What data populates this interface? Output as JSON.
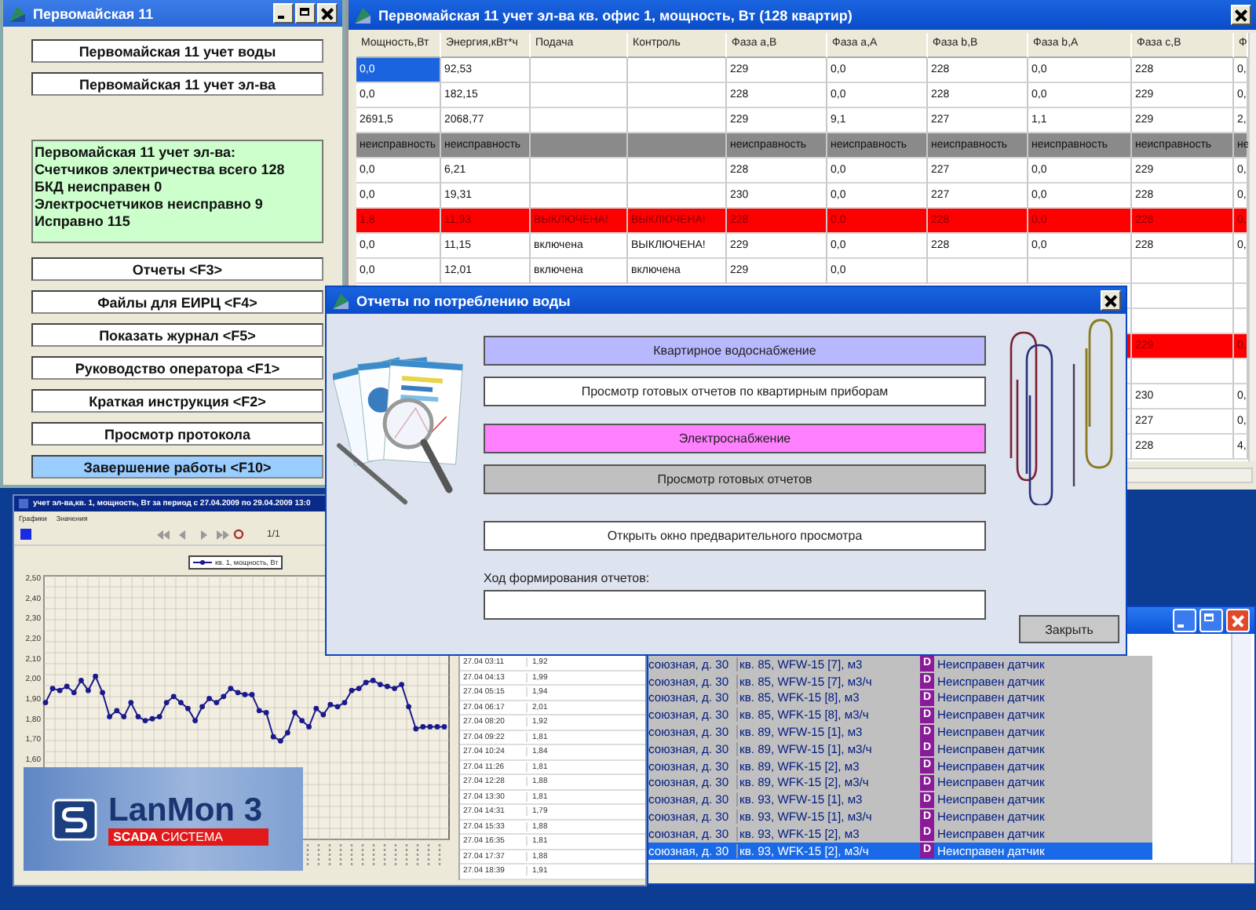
{
  "main_window": {
    "title": "Первомайская 11",
    "top_buttons": [
      "Первомайская 11 учет воды",
      "Первомайская 11 учет эл-ва"
    ],
    "info_lines": [
      "Первомайская 11 учет эл-ва:",
      "Счетчиков электричества всего 128",
      "БКД неисправен 0",
      "Электросчетчиков неисправно 9",
      "Исправно 115"
    ],
    "buttons": [
      {
        "label": "Отчеты <F3>",
        "selected": false
      },
      {
        "label": "Файлы для ЕИРЦ <F4>",
        "selected": false
      },
      {
        "label": "Показать журнал <F5>",
        "selected": false
      },
      {
        "label": "Руководство оператора <F1>",
        "selected": false
      },
      {
        "label": "Краткая инструкция <F2>",
        "selected": false
      },
      {
        "label": "Просмотр протокола",
        "selected": false
      },
      {
        "label": "Завершение работы <F10>",
        "selected": true
      }
    ]
  },
  "table_window": {
    "title": "Первомайская 11 учет эл-ва кв. офис 1, мощность, Вт (128 квартир)",
    "columns": [
      "Мощность,Вт",
      "Энергия,кВт*ч",
      "Подача",
      "Контроль",
      "Фаза a,В",
      "Фаза a,А",
      "Фаза b,В",
      "Фаза b,А",
      "Фаза c,В",
      "Ф"
    ],
    "rows": [
      {
        "kind": "normal",
        "selected": true,
        "cells": [
          "0,0",
          "92,53",
          null,
          null,
          "229",
          "0,0",
          "228",
          "0,0",
          "228",
          "0,"
        ]
      },
      {
        "kind": "normal",
        "selected": false,
        "cells": [
          "0,0",
          "182,15",
          null,
          null,
          "228",
          "0,0",
          "228",
          "0,0",
          "229",
          "0,"
        ]
      },
      {
        "kind": "normal",
        "selected": false,
        "cells": [
          "2691,5",
          "2068,77",
          null,
          null,
          "229",
          "9,1",
          "227",
          "1,1",
          "229",
          "2,"
        ]
      },
      {
        "kind": "fault",
        "selected": false,
        "cells": [
          "неисправность",
          "неисправность",
          null,
          null,
          "неисправность",
          "неисправность",
          "неисправность",
          "неисправность",
          "неисправность",
          "не"
        ]
      },
      {
        "kind": "normal",
        "selected": false,
        "cells": [
          "0,0",
          "6,21",
          null,
          null,
          "228",
          "0,0",
          "227",
          "0,0",
          "229",
          "0,"
        ]
      },
      {
        "kind": "normal",
        "selected": false,
        "cells": [
          "0,0",
          "19,31",
          null,
          null,
          "230",
          "0,0",
          "227",
          "0,0",
          "228",
          "0,"
        ]
      },
      {
        "kind": "alarm",
        "selected": false,
        "cells": [
          "1,8",
          "11,93",
          "ВЫКЛЮЧЕНА!",
          "ВЫКЛЮЧЕНА!",
          "228",
          "0,0",
          "228",
          "0,0",
          "228",
          "0,"
        ]
      },
      {
        "kind": "normal",
        "selected": false,
        "cells": [
          "0,0",
          "11,15",
          "включена",
          "ВЫКЛЮЧЕНА!",
          "229",
          "0,0",
          "228",
          "0,0",
          "228",
          "0,"
        ]
      },
      {
        "kind": "normal",
        "selected": false,
        "cells": [
          "0,0",
          "12,01",
          "включена",
          "включена",
          "229",
          "0,0",
          null,
          null,
          null,
          null
        ]
      }
    ],
    "lower_rows": [
      {
        "kind": "normal",
        "cells": [
          null,
          null
        ]
      },
      {
        "kind": "normal",
        "cells": [
          null,
          null
        ]
      },
      {
        "kind": "alarm",
        "cells": [
          "229",
          "0,"
        ]
      },
      {
        "kind": "normal",
        "cells": [
          null,
          null
        ]
      },
      {
        "kind": "normal",
        "cells": [
          "230",
          "0,"
        ]
      },
      {
        "kind": "normal",
        "cells": [
          "227",
          "0,"
        ]
      },
      {
        "kind": "normal",
        "cells": [
          "228",
          "4,"
        ]
      }
    ]
  },
  "chart_window": {
    "title": "учет эл-ва,кв. 1, мощность, Вт за период с 27.04.2009 по 29.04.2009 13:0",
    "menu": [
      "Графики",
      "Значения"
    ],
    "page": "1/1",
    "chart_data": {
      "type": "line",
      "grid": true,
      "ylim": [
        1.2,
        2.51
      ],
      "yticks": [
        {
          "value": 2.5,
          "label": "2,50"
        },
        {
          "value": 2.4,
          "label": "2,40"
        },
        {
          "value": 2.3,
          "label": "2,30"
        },
        {
          "value": 2.2,
          "label": "2,20"
        },
        {
          "value": 2.1,
          "label": "2,10"
        },
        {
          "value": 2.0,
          "label": "2,00"
        },
        {
          "value": 1.9,
          "label": "1,90"
        },
        {
          "value": 1.8,
          "label": "1,80"
        },
        {
          "value": 1.7,
          "label": "1,70"
        },
        {
          "value": 1.6,
          "label": "1,60"
        }
      ],
      "series": [
        {
          "name": "кв. 1, мощность, Вт",
          "color": "#1a1a8c",
          "values": [
            1.88,
            1.95,
            1.94,
            1.96,
            1.93,
            1.99,
            1.94,
            2.01,
            1.93,
            1.81,
            1.84,
            1.81,
            1.88,
            1.81,
            1.79,
            1.8,
            1.81,
            1.88,
            1.91,
            1.88,
            1.85,
            1.79,
            1.86,
            1.9,
            1.88,
            1.91,
            1.95,
            1.93,
            1.92,
            1.92,
            1.84,
            1.83,
            1.71,
            1.69,
            1.73,
            1.83,
            1.79,
            1.76,
            1.85,
            1.82,
            1.87,
            1.86,
            1.88,
            1.94,
            1.95,
            1.98,
            1.99,
            1.97,
            1.96,
            1.95,
            1.97,
            1.86,
            1.75,
            1.76,
            1.76,
            1.76,
            1.76
          ]
        }
      ]
    },
    "readings": [
      {
        "time": "27.04 03:11",
        "value": "1,92"
      },
      {
        "time": "27.04 04:13",
        "value": "1,99"
      },
      {
        "time": "27.04 05:15",
        "value": "1,94"
      },
      {
        "time": "27.04 06:17",
        "value": "2,01"
      },
      {
        "time": "27.04 08:20",
        "value": "1,92"
      },
      {
        "time": "27.04 09:22",
        "value": "1,81"
      },
      {
        "time": "27.04 10:24",
        "value": "1,84"
      },
      {
        "time": "27.04 11:26",
        "value": "1,81"
      },
      {
        "time": "27.04 12:28",
        "value": "1,88"
      },
      {
        "time": "27.04 13:30",
        "value": "1,81"
      },
      {
        "time": "27.04 14:31",
        "value": "1,79"
      },
      {
        "time": "27.04 15:33",
        "value": "1,88"
      },
      {
        "time": "27.04 16:35",
        "value": "1,81"
      },
      {
        "time": "27.04 17:37",
        "value": "1,88"
      },
      {
        "time": "27.04 18:39",
        "value": "1,91"
      }
    ]
  },
  "events_window": {
    "rows": [
      {
        "address": "союзная, д. 30",
        "point": "кв. 85, WFW-15 [7], м3",
        "flag": "D",
        "message": "Неисправен датчик",
        "selected": false
      },
      {
        "address": "союзная, д. 30",
        "point": "кв. 85, WFW-15 [7], м3/ч",
        "flag": "D",
        "message": "Неисправен датчик",
        "selected": false
      },
      {
        "address": "союзная, д. 30",
        "point": "кв. 85, WFK-15 [8], м3",
        "flag": "D",
        "message": "Неисправен датчик",
        "selected": false
      },
      {
        "address": "союзная, д. 30",
        "point": "кв. 85, WFK-15 [8], м3/ч",
        "flag": "D",
        "message": "Неисправен датчик",
        "selected": false
      },
      {
        "address": "союзная, д. 30",
        "point": "кв. 89, WFW-15 [1], м3",
        "flag": "D",
        "message": "Неисправен датчик",
        "selected": false
      },
      {
        "address": "союзная, д. 30",
        "point": "кв. 89, WFW-15 [1], м3/ч",
        "flag": "D",
        "message": "Неисправен датчик",
        "selected": false
      },
      {
        "address": "союзная, д. 30",
        "point": "кв. 89, WFK-15 [2], м3",
        "flag": "D",
        "message": "Неисправен датчик",
        "selected": false
      },
      {
        "address": "союзная, д. 30",
        "point": "кв. 89, WFK-15 [2], м3/ч",
        "flag": "D",
        "message": "Неисправен датчик",
        "selected": false
      },
      {
        "address": "союзная, д. 30",
        "point": "кв. 93, WFW-15 [1], м3",
        "flag": "D",
        "message": "Неисправен датчик",
        "selected": false
      },
      {
        "address": "союзная, д. 30",
        "point": "кв. 93, WFW-15 [1], м3/ч",
        "flag": "D",
        "message": "Неисправен датчик",
        "selected": false
      },
      {
        "address": "союзная, д. 30",
        "point": "кв. 93, WFK-15 [2], м3",
        "flag": "D",
        "message": "Неисправен датчик",
        "selected": false
      },
      {
        "address": "союзная, д. 30",
        "point": "кв. 93, WFK-15 [2], м3/ч",
        "flag": "D",
        "message": "Неисправен датчик",
        "selected": true
      }
    ]
  },
  "logo": {
    "name": "LanMon 3",
    "tag_bold": "SCADA",
    "tag": "СИСТЕМА"
  },
  "dialog": {
    "title": "Отчеты по потреблению воды",
    "buttons": [
      {
        "label": "Квартирное водоснабжение",
        "color": "#b8b8ff"
      },
      {
        "label": "Просмотр готовых отчетов по квартирным приборам",
        "color": "#ffffff"
      },
      {
        "label": "Электроснабжение",
        "color": "#ff80ff"
      },
      {
        "label": "Просмотр готовых отчетов",
        "color": "#c0c0c0"
      },
      {
        "label": "Открыть окно предварительного просмотра",
        "color": "#ffffff"
      }
    ],
    "progress_label": "Ход формирования отчетов:",
    "close_button": "Закрыть"
  }
}
